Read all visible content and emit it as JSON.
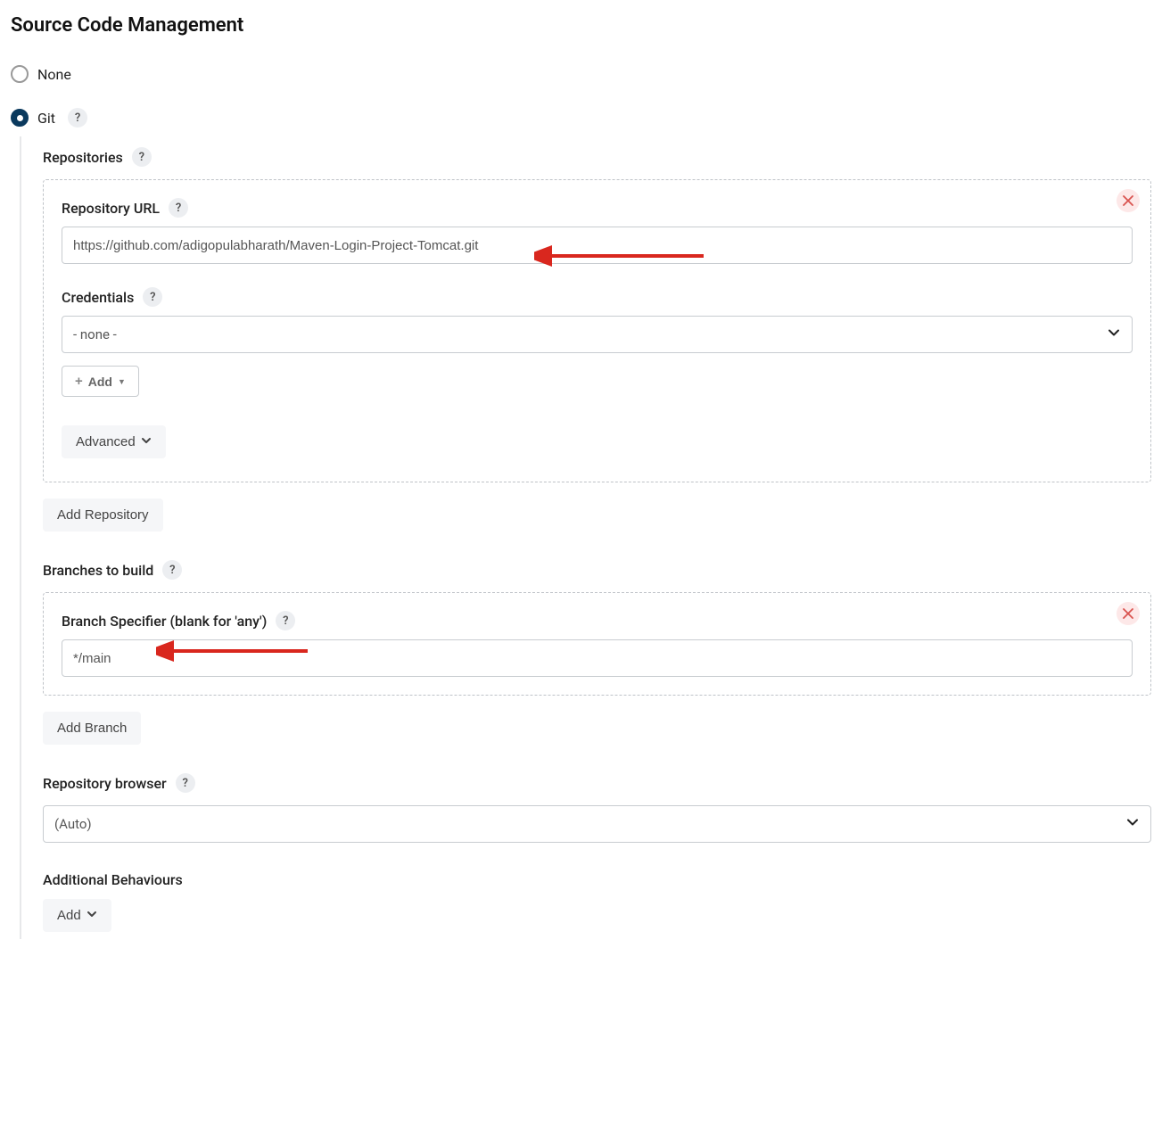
{
  "heading": "Source Code Management",
  "scm": {
    "none_label": "None",
    "git_label": "Git"
  },
  "repositories": {
    "section_label": "Repositories",
    "repo_url_label": "Repository URL",
    "repo_url_value": "https://github.com/adigopulabharath/Maven-Login-Project-Tomcat.git",
    "credentials_label": "Credentials",
    "credentials_value": "- none -",
    "add_cred_label": "Add",
    "advanced_label": "Advanced",
    "add_repository_label": "Add Repository"
  },
  "branches": {
    "section_label": "Branches to build",
    "specifier_label": "Branch Specifier (blank for 'any')",
    "specifier_value": "*/main",
    "add_branch_label": "Add Branch"
  },
  "repo_browser": {
    "label": "Repository browser",
    "value": "(Auto)"
  },
  "additional_behaviours": {
    "label": "Additional Behaviours",
    "add_label": "Add"
  },
  "colors": {
    "radio_selected": "#0b3a5e",
    "arrow": "#d9271e"
  }
}
